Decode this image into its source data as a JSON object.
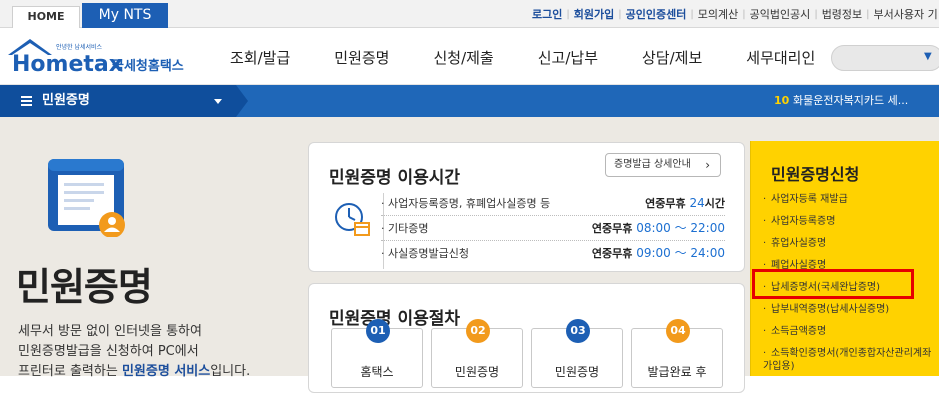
{
  "top_tabs": {
    "home": "HOME",
    "mynts": "My NTS"
  },
  "top_links": [
    "로그인",
    "회원가입",
    "공인인증센터",
    "모의계산",
    "공익법인공시",
    "법령정보",
    "부서사용자 기"
  ],
  "logo": {
    "small": "안녕한 납세서비스",
    "name": "Hometax",
    "org": "국세청홈택스"
  },
  "gnb": [
    "조회/발급",
    "민원증명",
    "신청/제출",
    "신고/납부",
    "상담/제보",
    "세무대리인"
  ],
  "subbar": {
    "title": "민원증명",
    "ticker_num": "10",
    "ticker_text": "화물운전자복지카드 세..."
  },
  "hero": {
    "title": "민원증명",
    "desc_1": "세무서 방문 없이 인터넷을 통하여",
    "desc_2": "민원증명발급을 신청하여 PC에서",
    "desc_3_pre": "프린터로 출력하는 ",
    "desc_3_em": "민원증명 서비스",
    "desc_3_post": "입니다."
  },
  "hours": {
    "title": "민원증명 이용시간",
    "detail_button": "증명발급 상세안내",
    "rows": [
      {
        "label": "· 사업자등록증명, 휴폐업사실증명 등",
        "prefix": "연중무휴",
        "num": "24",
        "suffix": "시간"
      },
      {
        "label": "· 기타증명",
        "prefix": "연중무휴",
        "num": "08:00 ～ 22:00",
        "suffix": ""
      },
      {
        "label": "· 사실증명발급신청",
        "prefix": "연중무휴",
        "num": "09:00 ～ 24:00",
        "suffix": ""
      }
    ]
  },
  "procedure": {
    "title": "민원증명 이용절차",
    "steps": [
      {
        "num": "01",
        "label": "홈택스",
        "color": "#1d5fb4"
      },
      {
        "num": "02",
        "label": "민원증명",
        "color": "#f29a1c"
      },
      {
        "num": "03",
        "label": "민원증명",
        "color": "#1d5fb4"
      },
      {
        "num": "04",
        "label": "발급완료 후",
        "color": "#f29a1c"
      }
    ]
  },
  "right_panel": {
    "title": "민원증명신청",
    "items": [
      "사업자등록 재발급",
      "사업자등록증명",
      "휴업사실증명",
      "폐업사실증명",
      "납세증명서(국세완납증명)",
      "납부내역증명(납세사실증명)",
      "소득금액증명",
      "소득확인증명서(개인종합자산관리계좌 가입용)"
    ],
    "highlight_color": "#e60000"
  },
  "colors": {
    "brand_blue": "#1d5fb4",
    "accent_yellow": "#ffd200"
  }
}
